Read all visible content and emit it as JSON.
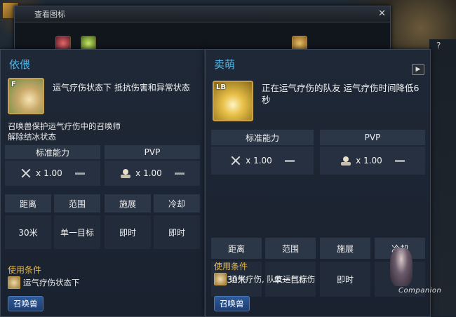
{
  "back_window": {
    "title": "查看图标"
  },
  "left_skill": {
    "name": "依偎",
    "key": "F",
    "description": "运气疗伤状态下 抵抗伤害和异常状态",
    "extra": "召唤兽保护运气疗伤中的召唤师\n解除结冰状态",
    "standard_label": "标准能力",
    "pvp_label": "PVP",
    "standard_mult": "x 1.00",
    "pvp_mult": "x 1.00",
    "stats_headers": [
      "距离",
      "范围",
      "施展",
      "冷却"
    ],
    "stats_values": [
      "30米",
      "单一目标",
      "即时",
      "即时"
    ],
    "condition_title": "使用条件",
    "condition_text": "运气疗伤状态下",
    "tag": "召唤兽"
  },
  "right_skill": {
    "name": "卖萌",
    "key": "LB",
    "description": "正在运气疗伤的队友 运气疗伤时间降低6秒",
    "standard_label": "标准能力",
    "pvp_label": "PVP",
    "standard_mult": "x 1.00",
    "pvp_mult": "x 1.00",
    "stats_headers": [
      "距离",
      "范围",
      "施展",
      "冷却"
    ],
    "stats_values": [
      "30米",
      "单一目标",
      "即时",
      "1秒"
    ],
    "condition_title": "使用条件",
    "condition_text": "运气疗伤, 队友运气疗伤",
    "tag": "召唤兽"
  },
  "watermark": {
    "text": "Companion"
  },
  "icons": {
    "close": "close-icon",
    "sword": "sword-icon",
    "pvp": "pvp-icon",
    "book": "book-icon",
    "help": "help-icon"
  },
  "colors": {
    "skill_name": "#4fb8e8",
    "condition_title": "#e8b84a",
    "tag": "#2e5a9a"
  }
}
